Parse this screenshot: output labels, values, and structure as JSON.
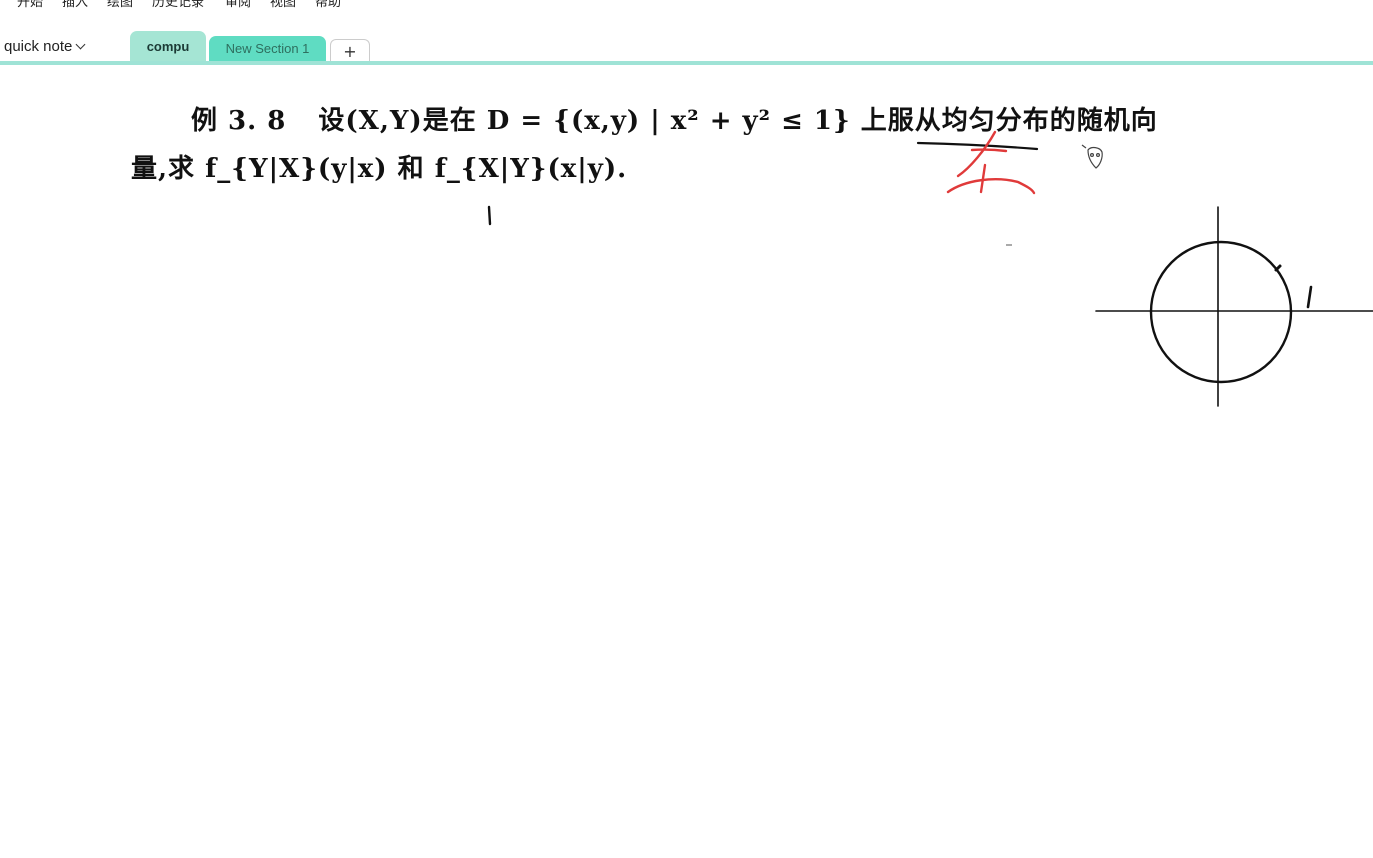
{
  "ribbon": {
    "items": [
      "开始",
      "插入",
      "绘图",
      "历史记录",
      "审阅",
      "视图",
      "帮助"
    ]
  },
  "notebook": {
    "name": "quick note"
  },
  "sections": {
    "tabs": [
      "compu",
      "New Section 1"
    ],
    "add_label": "+"
  },
  "page": {
    "problem_label": "例 3. 8",
    "line1_text": "设(X,Y)是在 D = {(x,y) | x² + y² ≤ 1} 上服从均匀分布的随机向",
    "line2_text": "量,求 f_{Y|X}(y|x) 和 f_{X|Y}(x|y).",
    "handwritten_label": "1"
  },
  "colors": {
    "accent_tab_active": "#a5e5d4",
    "accent_tab": "#5fdcc2",
    "tab_line": "#9fe3d6",
    "ink_black": "#111111",
    "ink_red": "#e03a3a"
  }
}
